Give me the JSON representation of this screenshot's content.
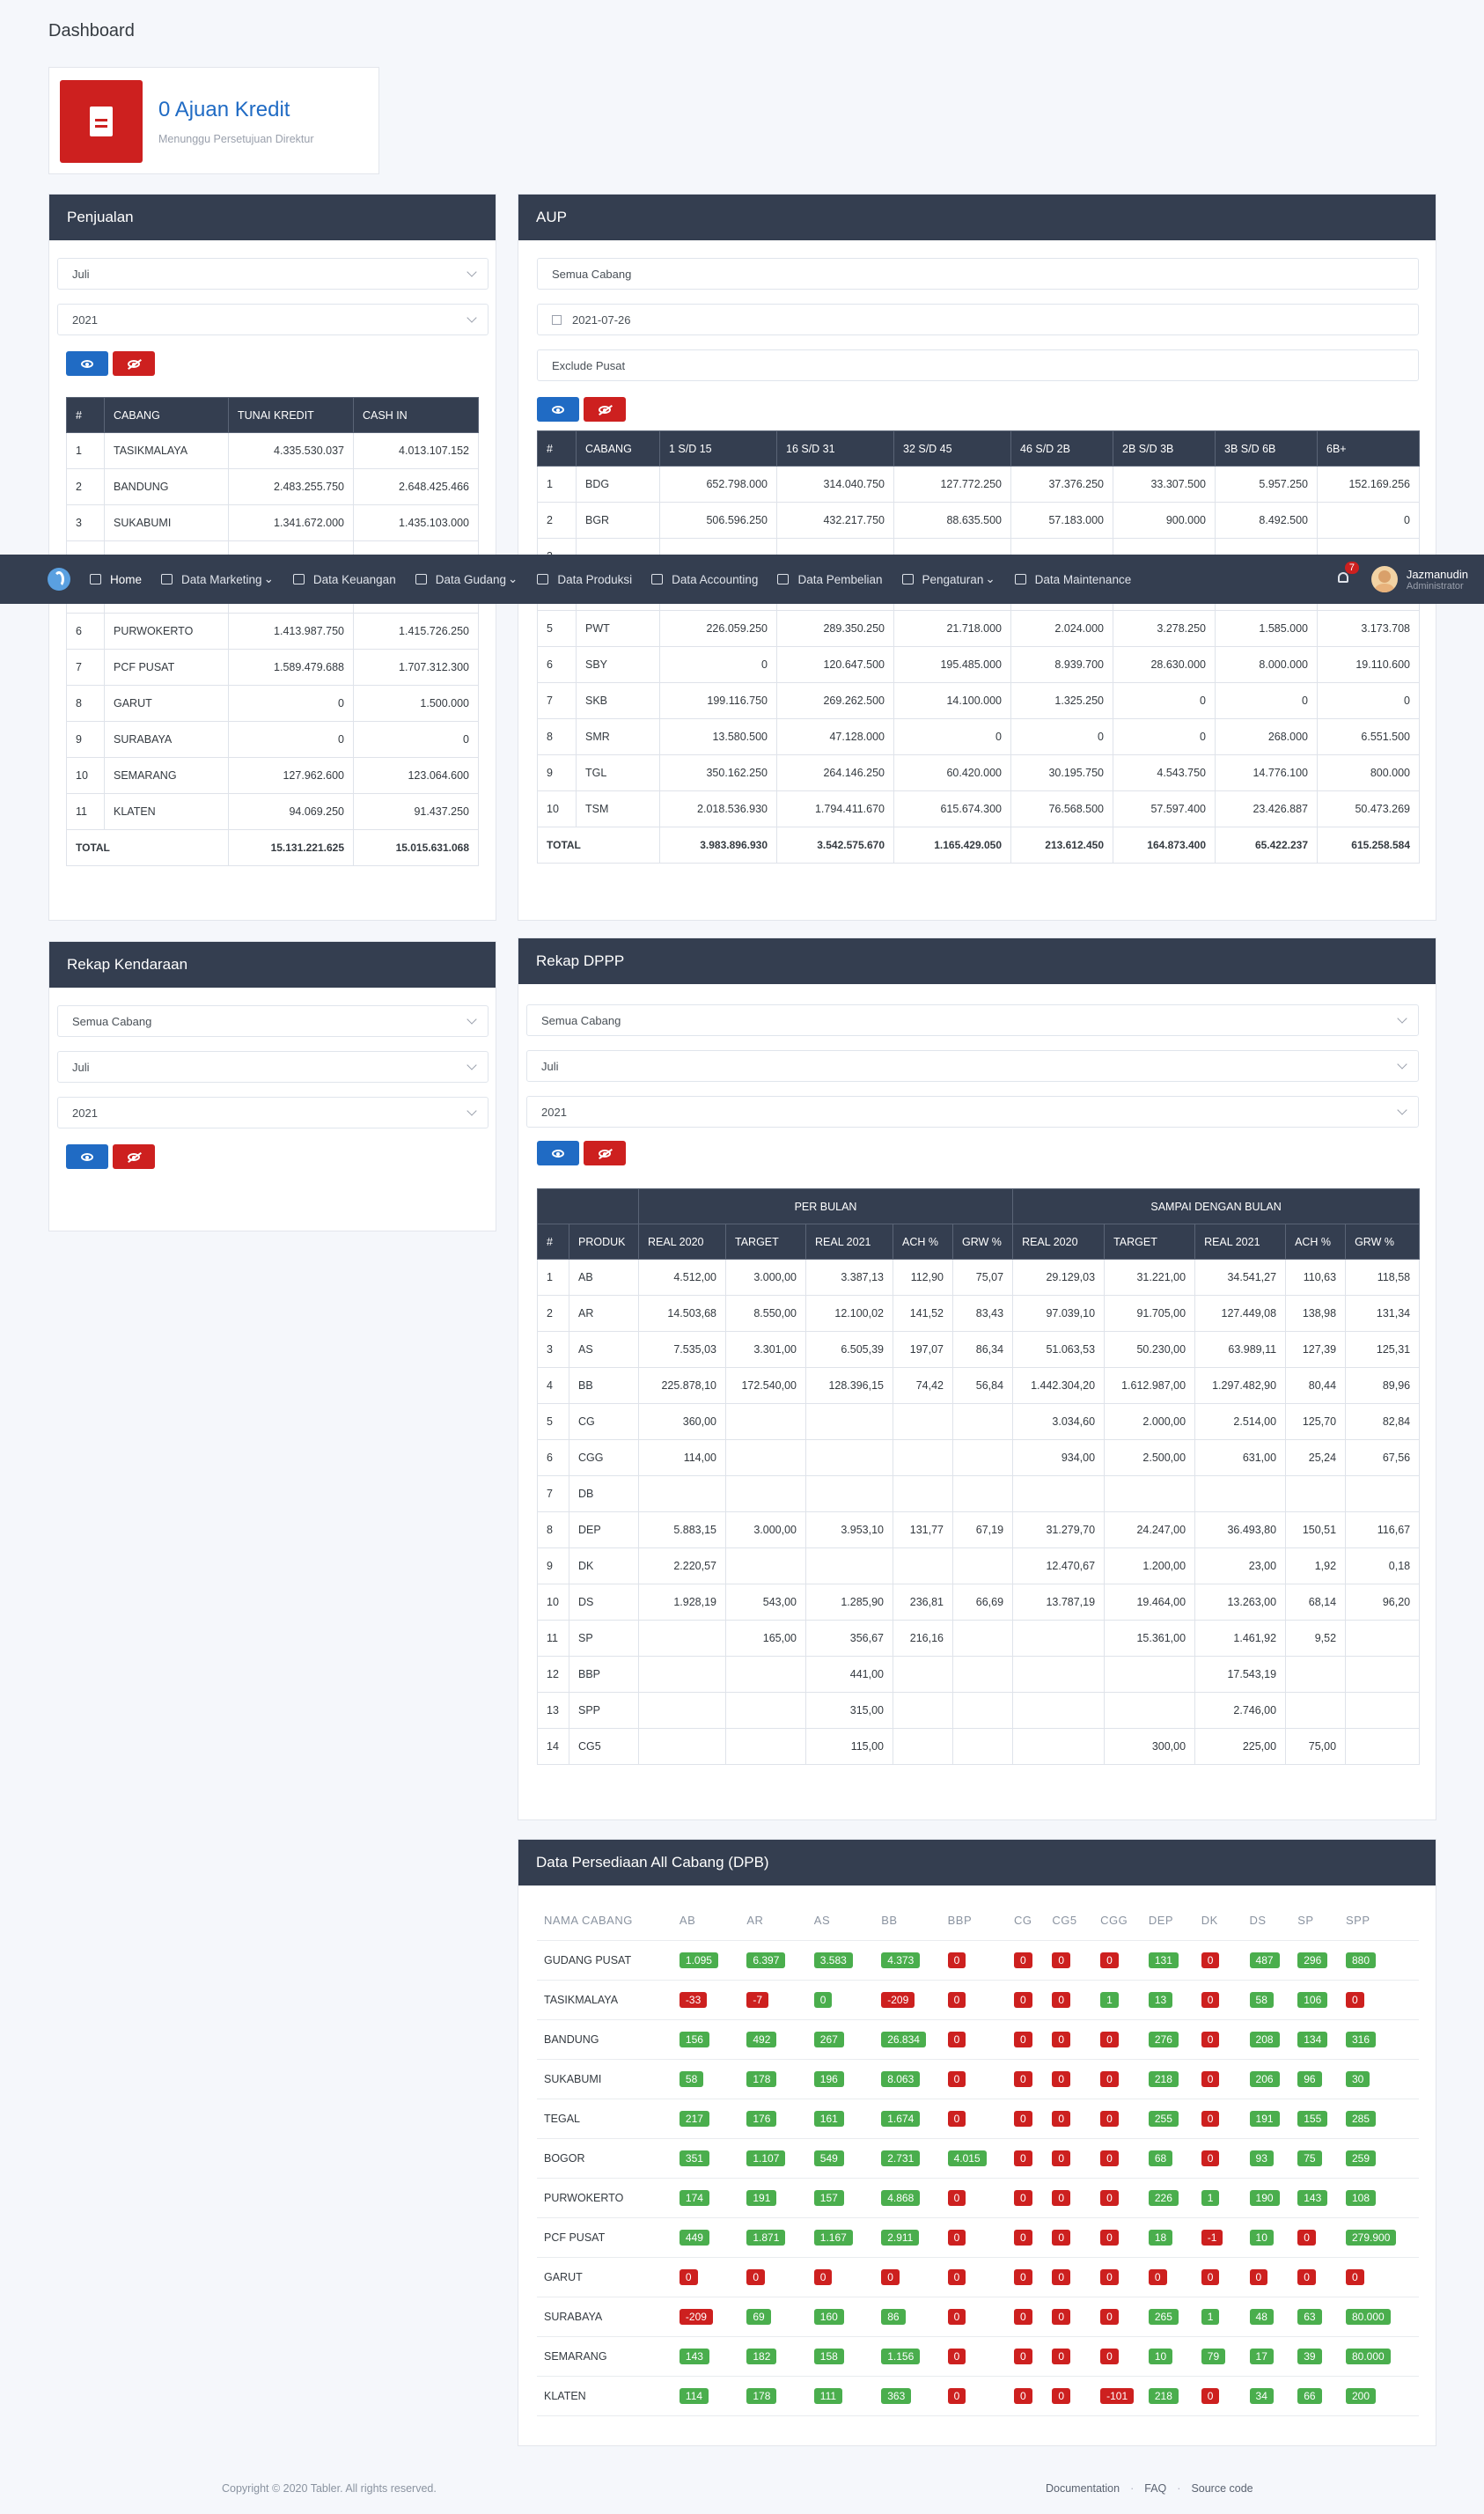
{
  "page_title": "Dashboard",
  "summary": {
    "title": "0 Ajuan Kredit",
    "subtitle": "Menunggu Persetujuan Direktur",
    "icon": "file-icon"
  },
  "navbar": {
    "items": [
      "Home",
      "Data Marketing",
      "Data Keuangan",
      "Data Gudang",
      "Data Produksi",
      "Data Accounting",
      "Data Pembelian",
      "Pengaturan",
      "Data Maintenance"
    ],
    "notif_count": "7",
    "user_name": "Jazmanudin",
    "user_role": "Administrator"
  },
  "penjualan": {
    "title": "Penjualan",
    "month": "Juli",
    "year": "2021",
    "headers": [
      "#",
      "CABANG",
      "TUNAI KREDIT",
      "CASH IN"
    ],
    "rows": [
      [
        "1",
        "TASIKMALAYA",
        "4.335.530.037",
        "4.013.107.152"
      ],
      [
        "2",
        "BANDUNG",
        "2.483.255.750",
        "2.648.425.466"
      ],
      [
        "3",
        "SUKABUMI",
        "1.341.672.000",
        "1.435.103.000"
      ],
      [
        "4",
        "",
        "",
        ""
      ],
      [
        "5",
        "",
        "",
        ""
      ],
      [
        "6",
        "PURWOKERTO",
        "1.413.987.750",
        "1.415.726.250"
      ],
      [
        "7",
        "PCF PUSAT",
        "1.589.479.688",
        "1.707.312.300"
      ],
      [
        "8",
        "GARUT",
        "0",
        "1.500.000"
      ],
      [
        "9",
        "SURABAYA",
        "0",
        "0"
      ],
      [
        "10",
        "SEMARANG",
        "127.962.600",
        "123.064.600"
      ],
      [
        "11",
        "KLATEN",
        "94.069.250",
        "91.437.250"
      ]
    ],
    "total": [
      "TOTAL",
      "15.131.221.625",
      "15.015.631.068"
    ]
  },
  "aup": {
    "title": "AUP",
    "branch": "Semua Cabang",
    "date": "2021-07-26",
    "exclude": "Exclude Pusat",
    "headers": [
      "#",
      "CABANG",
      "1 S/D 15",
      "16 S/D 31",
      "32 S/D 45",
      "46 S/D 2B",
      "2B S/D 3B",
      "3B S/D 6B",
      "6B+"
    ],
    "rows": [
      [
        "1",
        "BDG",
        "652.798.000",
        "314.040.750",
        "127.772.250",
        "37.376.250",
        "33.307.500",
        "5.957.250",
        "152.169.256"
      ],
      [
        "2",
        "BGR",
        "506.596.250",
        "432.217.750",
        "88.635.500",
        "57.183.000",
        "900.000",
        "8.492.500",
        "0"
      ],
      [
        "3",
        "",
        "",
        "",
        "",
        "",
        "",
        "",
        ""
      ],
      [
        "4",
        "",
        "",
        "",
        "",
        "",
        "",
        "",
        ""
      ],
      [
        "5",
        "PWT",
        "226.059.250",
        "289.350.250",
        "21.718.000",
        "2.024.000",
        "3.278.250",
        "1.585.000",
        "3.173.708"
      ],
      [
        "6",
        "SBY",
        "0",
        "120.647.500",
        "195.485.000",
        "8.939.700",
        "28.630.000",
        "8.000.000",
        "19.110.600"
      ],
      [
        "7",
        "SKB",
        "199.116.750",
        "269.262.500",
        "14.100.000",
        "1.325.250",
        "0",
        "0",
        "0"
      ],
      [
        "8",
        "SMR",
        "13.580.500",
        "47.128.000",
        "0",
        "0",
        "0",
        "268.000",
        "6.551.500"
      ],
      [
        "9",
        "TGL",
        "350.162.250",
        "264.146.250",
        "60.420.000",
        "30.195.750",
        "4.543.750",
        "14.776.100",
        "800.000"
      ],
      [
        "10",
        "TSM",
        "2.018.536.930",
        "1.794.411.670",
        "615.674.300",
        "76.568.500",
        "57.597.400",
        "23.426.887",
        "50.473.269"
      ]
    ],
    "total": [
      "TOTAL",
      "3.983.896.930",
      "3.542.575.670",
      "1.165.429.050",
      "213.612.450",
      "164.873.400",
      "65.422.237",
      "615.258.584"
    ]
  },
  "rekap_kendaraan": {
    "title": "Rekap Kendaraan",
    "branch": "Semua Cabang",
    "month": "Juli",
    "year": "2021"
  },
  "rekap_dppp": {
    "title": "Rekap DPPP",
    "branch": "Semua Cabang",
    "month": "Juli",
    "year": "2021",
    "group_headers": [
      "PER BULAN",
      "SAMPAI DENGAN BULAN"
    ],
    "headers": [
      "#",
      "PRODUK",
      "REAL 2020",
      "TARGET",
      "REAL 2021",
      "ACH %",
      "GRW %",
      "REAL 2020",
      "TARGET",
      "REAL 2021",
      "ACH %",
      "GRW %"
    ],
    "rows": [
      [
        "1",
        "AB",
        "4.512,00",
        "3.000,00",
        "3.387,13",
        "112,90",
        "75,07",
        "29.129,03",
        "31.221,00",
        "34.541,27",
        "110,63",
        "118,58"
      ],
      [
        "2",
        "AR",
        "14.503,68",
        "8.550,00",
        "12.100,02",
        "141,52",
        "83,43",
        "97.039,10",
        "91.705,00",
        "127.449,08",
        "138,98",
        "131,34"
      ],
      [
        "3",
        "AS",
        "7.535,03",
        "3.301,00",
        "6.505,39",
        "197,07",
        "86,34",
        "51.063,53",
        "50.230,00",
        "63.989,11",
        "127,39",
        "125,31"
      ],
      [
        "4",
        "BB",
        "225.878,10",
        "172.540,00",
        "128.396,15",
        "74,42",
        "56,84",
        "1.442.304,20",
        "1.612.987,00",
        "1.297.482,90",
        "80,44",
        "89,96"
      ],
      [
        "5",
        "CG",
        "360,00",
        "",
        "",
        "",
        "",
        "3.034,60",
        "2.000,00",
        "2.514,00",
        "125,70",
        "82,84"
      ],
      [
        "6",
        "CGG",
        "114,00",
        "",
        "",
        "",
        "",
        "934,00",
        "2.500,00",
        "631,00",
        "25,24",
        "67,56"
      ],
      [
        "7",
        "DB",
        "",
        "",
        "",
        "",
        "",
        "",
        "",
        "",
        "",
        ""
      ],
      [
        "8",
        "DEP",
        "5.883,15",
        "3.000,00",
        "3.953,10",
        "131,77",
        "67,19",
        "31.279,70",
        "24.247,00",
        "36.493,80",
        "150,51",
        "116,67"
      ],
      [
        "9",
        "DK",
        "2.220,57",
        "",
        "",
        "",
        "",
        "12.470,67",
        "1.200,00",
        "23,00",
        "1,92",
        "0,18"
      ],
      [
        "10",
        "DS",
        "1.928,19",
        "543,00",
        "1.285,90",
        "236,81",
        "66,69",
        "13.787,19",
        "19.464,00",
        "13.263,00",
        "68,14",
        "96,20"
      ],
      [
        "11",
        "SP",
        "",
        "165,00",
        "356,67",
        "216,16",
        "",
        "",
        "15.361,00",
        "1.461,92",
        "9,52",
        ""
      ],
      [
        "12",
        "BBP",
        "",
        "",
        "441,00",
        "",
        "",
        "",
        "",
        "17.543,19",
        "",
        ""
      ],
      [
        "13",
        "SPP",
        "",
        "",
        "315,00",
        "",
        "",
        "",
        "",
        "2.746,00",
        "",
        ""
      ],
      [
        "14",
        "CG5",
        "",
        "",
        "115,00",
        "",
        "",
        "",
        "300,00",
        "225,00",
        "75,00",
        ""
      ]
    ]
  },
  "persediaan": {
    "title": "Data Persediaan All Cabang (DPB)",
    "headers": [
      "NAMA CABANG",
      "AB",
      "AR",
      "AS",
      "BB",
      "BBP",
      "CG",
      "CG5",
      "CGG",
      "DEP",
      "DK",
      "DS",
      "SP",
      "SPP"
    ],
    "rows": [
      [
        "GUDANG PUSAT",
        "1.095",
        "6.397",
        "3.583",
        "4.373",
        "0",
        "0",
        "0",
        "0",
        "131",
        "0",
        "487",
        "296",
        "880"
      ],
      [
        "TASIKMALAYA",
        "-33",
        "-7",
        "0",
        "-209",
        "0",
        "0",
        "0",
        "1",
        "13",
        "0",
        "58",
        "106",
        "0"
      ],
      [
        "BANDUNG",
        "156",
        "492",
        "267",
        "26.834",
        "0",
        "0",
        "0",
        "0",
        "276",
        "0",
        "208",
        "134",
        "316"
      ],
      [
        "SUKABUMI",
        "58",
        "178",
        "196",
        "8.063",
        "0",
        "0",
        "0",
        "0",
        "218",
        "0",
        "206",
        "96",
        "30"
      ],
      [
        "TEGAL",
        "217",
        "176",
        "161",
        "1.674",
        "0",
        "0",
        "0",
        "0",
        "255",
        "0",
        "191",
        "155",
        "285"
      ],
      [
        "BOGOR",
        "351",
        "1.107",
        "549",
        "2.731",
        "4.015",
        "0",
        "0",
        "0",
        "68",
        "0",
        "93",
        "75",
        "259"
      ],
      [
        "PURWOKERTO",
        "174",
        "191",
        "157",
        "4.868",
        "0",
        "0",
        "0",
        "0",
        "226",
        "1",
        "190",
        "143",
        "108"
      ],
      [
        "PCF PUSAT",
        "449",
        "1.871",
        "1.167",
        "2.911",
        "0",
        "0",
        "0",
        "0",
        "18",
        "-1",
        "10",
        "0",
        "279.900"
      ],
      [
        "GARUT",
        "0",
        "0",
        "0",
        "0",
        "0",
        "0",
        "0",
        "0",
        "0",
        "0",
        "0",
        "0",
        "0"
      ],
      [
        "SURABAYA",
        "-209",
        "69",
        "160",
        "86",
        "0",
        "0",
        "0",
        "0",
        "265",
        "1",
        "48",
        "63",
        "80.000"
      ],
      [
        "SEMARANG",
        "143",
        "182",
        "158",
        "1.156",
        "0",
        "0",
        "0",
        "0",
        "10",
        "79",
        "17",
        "39",
        "80.000"
      ],
      [
        "KLATEN",
        "114",
        "178",
        "111",
        "363",
        "0",
        "0",
        "0",
        "-101",
        "218",
        "0",
        "34",
        "66",
        "200"
      ]
    ],
    "red_cells": [
      [
        0,
        4
      ],
      [
        0,
        5
      ],
      [
        0,
        6
      ],
      [
        0,
        7
      ],
      [
        0,
        9
      ],
      [
        1,
        0
      ],
      [
        1,
        1
      ],
      [
        1,
        3
      ],
      [
        1,
        4
      ],
      [
        1,
        5
      ],
      [
        1,
        6
      ],
      [
        1,
        9
      ],
      [
        1,
        12
      ],
      [
        2,
        4
      ],
      [
        2,
        5
      ],
      [
        2,
        6
      ],
      [
        2,
        7
      ],
      [
        2,
        9
      ],
      [
        3,
        4
      ],
      [
        3,
        5
      ],
      [
        3,
        6
      ],
      [
        3,
        7
      ],
      [
        3,
        9
      ],
      [
        4,
        4
      ],
      [
        4,
        5
      ],
      [
        4,
        6
      ],
      [
        4,
        7
      ],
      [
        4,
        9
      ],
      [
        5,
        5
      ],
      [
        5,
        6
      ],
      [
        5,
        7
      ],
      [
        5,
        9
      ],
      [
        6,
        4
      ],
      [
        6,
        5
      ],
      [
        6,
        6
      ],
      [
        6,
        7
      ],
      [
        7,
        4
      ],
      [
        7,
        5
      ],
      [
        7,
        6
      ],
      [
        7,
        7
      ],
      [
        7,
        9
      ],
      [
        7,
        11
      ],
      [
        8,
        0
      ],
      [
        8,
        1
      ],
      [
        8,
        2
      ],
      [
        8,
        3
      ],
      [
        8,
        4
      ],
      [
        8,
        5
      ],
      [
        8,
        6
      ],
      [
        8,
        7
      ],
      [
        8,
        8
      ],
      [
        8,
        9
      ],
      [
        8,
        10
      ],
      [
        8,
        11
      ],
      [
        8,
        12
      ],
      [
        9,
        0
      ],
      [
        9,
        4
      ],
      [
        9,
        5
      ],
      [
        9,
        6
      ],
      [
        9,
        7
      ],
      [
        10,
        4
      ],
      [
        10,
        5
      ],
      [
        10,
        6
      ],
      [
        10,
        7
      ],
      [
        11,
        4
      ],
      [
        11,
        5
      ],
      [
        11,
        6
      ],
      [
        11,
        7
      ],
      [
        11,
        9
      ]
    ]
  },
  "footer": {
    "copyright": "Copyright © 2020 Tabler. All rights reserved.",
    "links": [
      "Documentation",
      "FAQ",
      "Source code"
    ]
  },
  "colors": {
    "header": "#343e50",
    "primary": "#206bc4",
    "danger": "#cd201f",
    "success": "#4aae4d"
  }
}
